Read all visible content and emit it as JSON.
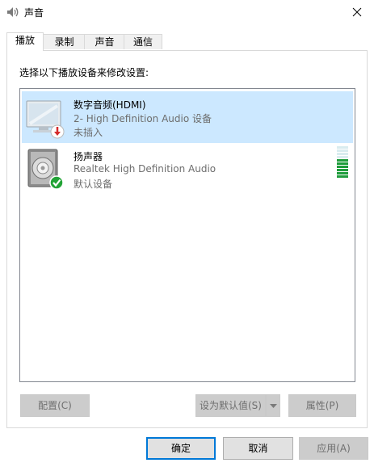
{
  "window": {
    "title": "声音"
  },
  "tabs": [
    {
      "label": "播放"
    },
    {
      "label": "录制"
    },
    {
      "label": "声音"
    },
    {
      "label": "通信"
    }
  ],
  "instruction": "选择以下播放设备来修改设置:",
  "devices": [
    {
      "name": "数字音频(HDMI)",
      "description": "2- High Definition Audio 设备",
      "status": "未插入",
      "icon": "hdmi-monitor-icon",
      "badge": "red-down-arrow"
    },
    {
      "name": "扬声器",
      "description": "Realtek High Definition Audio",
      "status": "默认设备",
      "icon": "speaker-icon",
      "badge": "green-check",
      "level_bars": 10,
      "level_active": 6
    }
  ],
  "panel_buttons": {
    "configure": "配置(C)",
    "set_default": "设为默认值(S)",
    "properties": "属性(P)"
  },
  "footer_buttons": {
    "ok": "确定",
    "cancel": "取消",
    "apply": "应用(A)"
  },
  "colors": {
    "selection": "#cce8ff",
    "focus_border": "#0078d7",
    "meter_active": "#1f9c3c",
    "meter_inactive": "#d9ecef"
  }
}
